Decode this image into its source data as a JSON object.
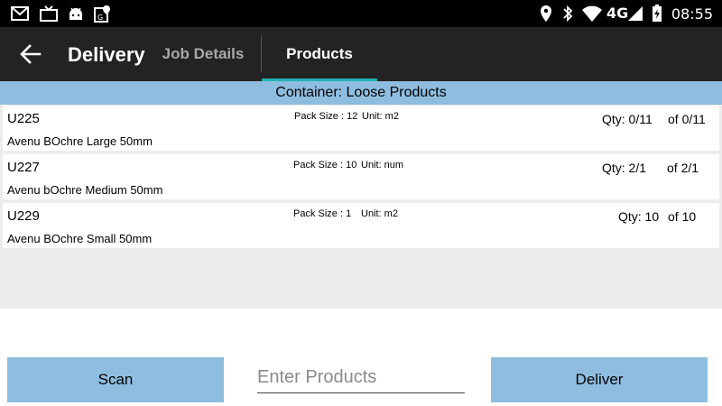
{
  "status_bar": {
    "time": "08:55",
    "network": "4G",
    "icons": [
      "gmail-icon",
      "tv-icon",
      "android-icon",
      "maps-icon",
      "location-icon",
      "bluetooth-icon",
      "wifi-icon",
      "signal-icon",
      "battery-icon"
    ]
  },
  "app_bar": {
    "title": "Delivery",
    "tabs": [
      {
        "label": "Job Details",
        "selected": false
      },
      {
        "label": "Products",
        "selected": true
      }
    ],
    "accent_color": "#21b3b3"
  },
  "container": {
    "label": "Container: Loose Products"
  },
  "products": [
    {
      "code": "U225",
      "description": "Avenu BOchre Large 50mm",
      "pack_size": "Pack Size :  12",
      "unit": "Unit: m2",
      "qty": "Qty: 0/11",
      "of": "of  0/11"
    },
    {
      "code": "U227",
      "description": "Avenu bOchre Medium 50mm",
      "pack_size": "Pack Size : 10",
      "unit": "Unit: num",
      "qty": "Qty:  2/1",
      "of": "of 2/1"
    },
    {
      "code": "U229",
      "description": "Avenu BOchre Small 50mm",
      "pack_size": "Pack Size : 1",
      "unit": "Unit: m2",
      "qty": "Qty: 10",
      "of": "of 10"
    }
  ],
  "bottom": {
    "scan_label": "Scan",
    "enter_placeholder": "Enter Products",
    "enter_value": "",
    "deliver_label": "Deliver",
    "button_color": "#8fbde0"
  }
}
